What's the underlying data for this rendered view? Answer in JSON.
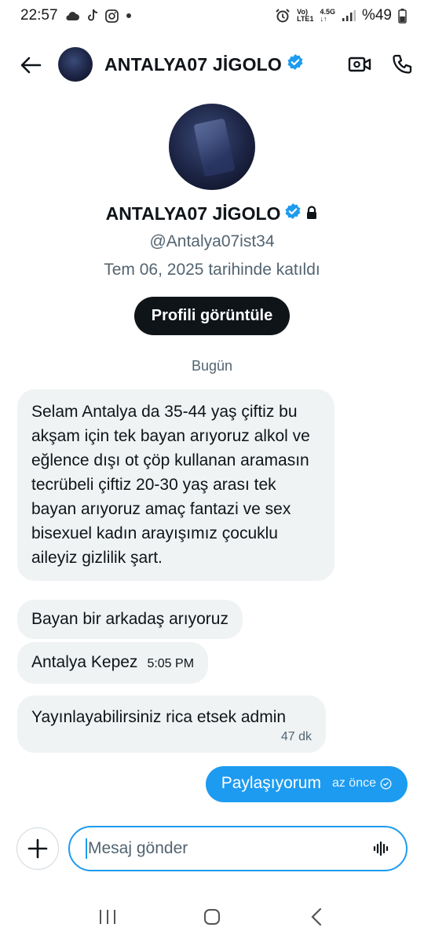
{
  "status_bar": {
    "time": "22:57",
    "network_top": "Vo)",
    "network_bottom": "LTE1",
    "data_top": "4.5G",
    "data_bottom": "↓↑",
    "battery": "%49",
    "icons": [
      "cloud-icon",
      "tiktok-icon",
      "instagram-icon",
      "dot-icon",
      "alarm-icon",
      "signal-icon",
      "battery-icon"
    ]
  },
  "header": {
    "title": "ANTALYA07 JİGOLO",
    "verified": true,
    "accent": "#1d9bf0"
  },
  "profile": {
    "name": "ANTALYA07 JİGOLO",
    "handle": "@Antalya07ist34",
    "joined": "Tem 06, 2025 tarihinde katıldı",
    "view_button": "Profili görüntüle"
  },
  "day_separator": "Bugün",
  "messages": [
    {
      "text": "Selam Antalya da 35-44 yaş çiftiz bu akşam için tek  bayan arıyoruz alkol ve eğlence dışı ot çöp kullanan aramasın tecrübeli çiftiz 20-30 yaş arası tek bayan arıyoruz amaç fantazi ve sex bisexuel kadın arayışımız çocuklu aileyiz gizlilik şart.",
      "time": ""
    },
    {
      "text": "Bayan bir arkadaş arıyoruz",
      "time": ""
    },
    {
      "text": "Antalya Kepez",
      "time": "5:05 PM"
    },
    {
      "text": "Yayınlayabilirsiniz rica etsek admin",
      "time": "47 dk"
    }
  ],
  "outgoing": {
    "text": "Paylaşıyorum",
    "time": "az önce",
    "color": "#1d9bf0"
  },
  "compose": {
    "placeholder": "Mesaj gönder",
    "value": ""
  }
}
